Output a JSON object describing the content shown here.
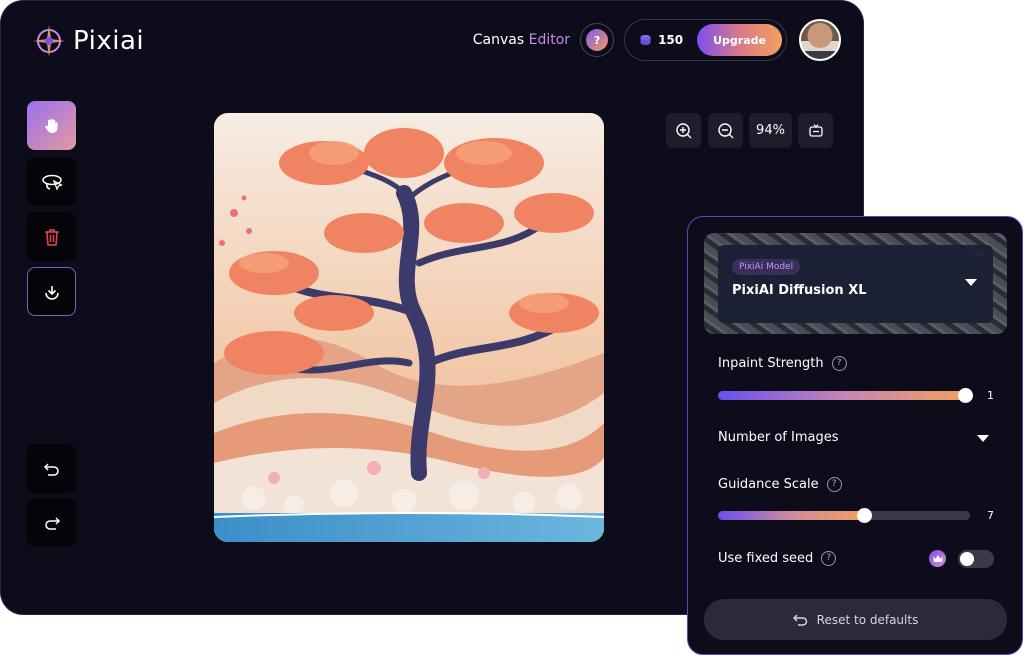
{
  "app": {
    "name": "Pixiai"
  },
  "header": {
    "title_part1": "Canvas ",
    "title_part2": "Editor",
    "help_label": "?",
    "credits": "150",
    "upgrade_label": "Upgrade"
  },
  "toolbar": {
    "tools": [
      {
        "name": "hand-tool",
        "icon": "hand-icon",
        "active": true
      },
      {
        "name": "lasso-tool",
        "icon": "lasso-icon",
        "active": false
      },
      {
        "name": "delete-tool",
        "icon": "trash-icon",
        "active": false
      },
      {
        "name": "download-tool",
        "icon": "download-icon",
        "active": false
      }
    ],
    "history": [
      {
        "name": "undo",
        "icon": "undo-icon"
      },
      {
        "name": "redo",
        "icon": "redo-icon"
      }
    ]
  },
  "zoom": {
    "level": "94%",
    "icons": [
      "zoom-in-icon",
      "zoom-out-icon",
      "fit-screen-icon"
    ]
  },
  "panel": {
    "model": {
      "tag": "PixiAi Model",
      "name": "PixiAI Diffusion XL"
    },
    "inpaint": {
      "label": "Inpaint Strength",
      "help": "?",
      "value": "1",
      "fill": 0.98
    },
    "images": {
      "label": "Number of Images"
    },
    "guidance": {
      "label": "Guidance Scale",
      "help": "?",
      "value": "7",
      "fill": 0.58
    },
    "seed": {
      "label": "Use fixed seed",
      "help": "?",
      "enabled": false
    },
    "reset_label": "Reset to defaults"
  },
  "colors": {
    "background": "#0c0c1a",
    "accent_purple": "#7a4ff0",
    "accent_orange": "#f3a05c",
    "panel_border": "#5a47c8",
    "trash_red": "#e8484a"
  }
}
